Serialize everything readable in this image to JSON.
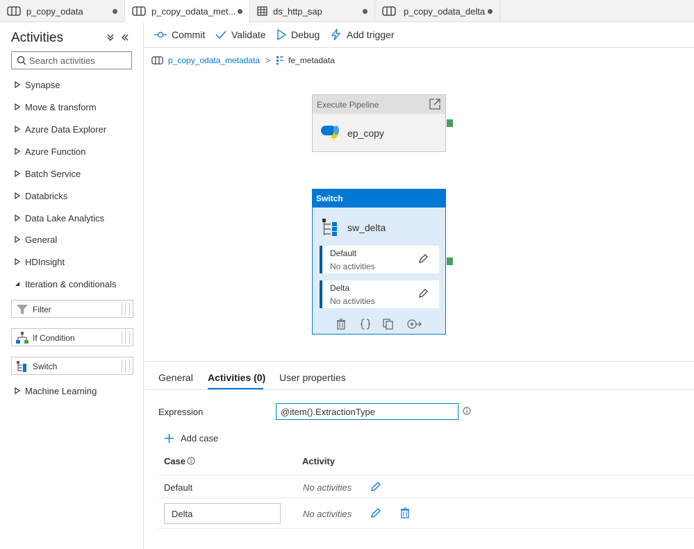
{
  "tabs": [
    {
      "label": "p_copy_odata",
      "icon": "pipeline-icon"
    },
    {
      "label": "p_copy_odata_met...",
      "icon": "pipeline-icon"
    },
    {
      "label": "ds_http_sap",
      "icon": "table-icon"
    },
    {
      "label": "p_copy_odata_delta",
      "icon": "pipeline-icon"
    }
  ],
  "sidebar": {
    "title": "Activities",
    "collapse_all_icon": "double-chevron-down-icon",
    "hide_icon": "double-chevron-left-icon",
    "search_placeholder": "Search activities",
    "categories": [
      "Synapse",
      "Move & transform",
      "Azure Data Explorer",
      "Azure Function",
      "Batch Service",
      "Databricks",
      "Data Lake Analytics",
      "General",
      "HDInsight",
      "Iteration & conditionals"
    ],
    "iteration_items": [
      "Filter",
      "If Condition",
      "Switch"
    ],
    "last_category": "Machine Learning"
  },
  "toolbar": {
    "commit": "Commit",
    "validate": "Validate",
    "debug": "Debug",
    "add_trigger": "Add trigger"
  },
  "breadcrumb": {
    "pipeline": "p_copy_odata_metadata",
    "separator": ">",
    "activity": "fe_metadata"
  },
  "canvas": {
    "execute_pipeline": {
      "header": "Execute Pipeline",
      "name": "ep_copy"
    },
    "switch": {
      "header": "Switch",
      "name": "sw_delta",
      "cases": [
        {
          "name": "Default",
          "activities": "No activities"
        },
        {
          "name": "Delta",
          "activities": "No activities"
        }
      ]
    }
  },
  "properties": {
    "tabs": [
      "General",
      "Activities (0)",
      "User properties"
    ],
    "active_tab": "Activities (0)",
    "expression_label": "Expression",
    "expression_value": "@item().ExtractionType",
    "add_case": "Add case",
    "columns": {
      "case": "Case",
      "activity": "Activity"
    },
    "rows": [
      {
        "case": "Default",
        "activity": "No activities"
      },
      {
        "case": "Delta",
        "activity": "No activities"
      }
    ]
  },
  "colors": {
    "accent": "#0078d4",
    "port": "#4a9e5c",
    "switch_body": "#deecf9"
  }
}
